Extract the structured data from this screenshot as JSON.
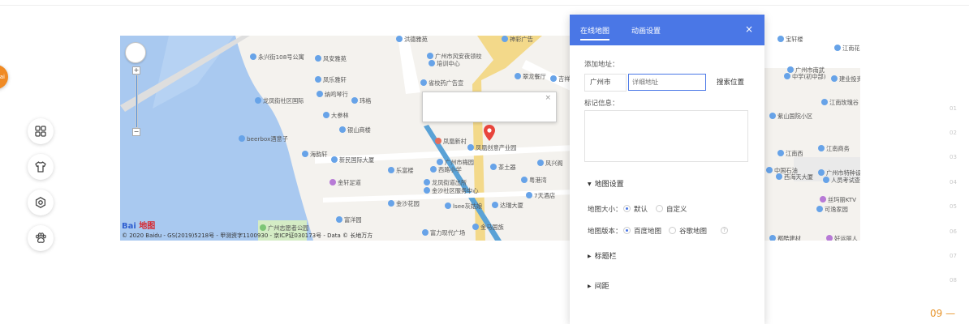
{
  "orange_tab": "ai",
  "toolbar": [
    {
      "name": "grid-icon"
    },
    {
      "name": "shirt-icon"
    },
    {
      "name": "settings-icon"
    },
    {
      "name": "paw-icon"
    }
  ],
  "map": {
    "pois": [
      {
        "t": "洪德雅苑",
        "c": "#67a3e8"
      },
      {
        "t": "神彩广告",
        "c": "#67a3e8"
      },
      {
        "t": "永兴街108号公寓",
        "c": "#67a3e8"
      },
      {
        "t": "风安雅苑",
        "c": "#67a3e8"
      },
      {
        "t": "广州市风安夜领校",
        "c": "#67a3e8"
      },
      {
        "t": "培训中心",
        "c": "#67a3e8"
      },
      {
        "t": "凤乐雅轩",
        "c": "#67a3e8"
      },
      {
        "t": "省校药广告宣",
        "c": "#67a3e8"
      },
      {
        "t": "翠龙餐厅",
        "c": "#67a3e8"
      },
      {
        "t": "吉祥永照",
        "c": "#67a3e8"
      },
      {
        "t": "龙凤街社区国际",
        "c": "#67a3e8"
      },
      {
        "t": "纳鸣琴行",
        "c": "#67a3e8"
      },
      {
        "t": "玮格",
        "c": "#67a3e8"
      },
      {
        "t": "大参林",
        "c": "#67a3e8"
      },
      {
        "t": "银山商楼",
        "c": "#67a3e8"
      },
      {
        "t": "beerbox酒意子",
        "c": "#67a3e8"
      },
      {
        "t": "凤凰新村",
        "c": "#e56c5a"
      },
      {
        "t": "凤凰创意产业园",
        "c": "#67a3e8"
      },
      {
        "t": "海韵轩",
        "c": "#67a3e8"
      },
      {
        "t": "新民国际大厦",
        "c": "#67a3e8"
      },
      {
        "t": "广州市梅园",
        "c": "#67a3e8"
      },
      {
        "t": "西路小学",
        "c": "#67a3e8"
      },
      {
        "t": "风兴阁",
        "c": "#67a3e8"
      },
      {
        "t": "乐富楼",
        "c": "#67a3e8"
      },
      {
        "t": "茶土器",
        "c": "#67a3e8"
      },
      {
        "t": "粤港湾",
        "c": "#67a3e8"
      },
      {
        "t": "金轩足道",
        "c": "#b77ad6"
      },
      {
        "t": "龙凤街道出所",
        "c": "#67a3e8"
      },
      {
        "t": "金沙社区服务中心",
        "c": "#67a3e8"
      },
      {
        "t": "7天酒店",
        "c": "#67a3e8"
      },
      {
        "t": "金沙花园",
        "c": "#67a3e8"
      },
      {
        "t": "lsee灰姑娘",
        "c": "#67a3e8"
      },
      {
        "t": "达瑞大厦",
        "c": "#67a3e8"
      },
      {
        "t": "富洋园",
        "c": "#67a3e8"
      },
      {
        "t": "金马国族",
        "c": "#67a3e8"
      },
      {
        "t": "富力现代广场",
        "c": "#67a3e8"
      },
      {
        "t": "广州志愿者公园",
        "c": "#7cc576"
      },
      {
        "t": "宝轩楼",
        "c": "#67a3e8"
      },
      {
        "t": "江南花",
        "c": "#67a3e8"
      },
      {
        "t": "广州市南武",
        "c": "#67a3e8"
      },
      {
        "t": "中学(初中部)",
        "c": "#67a3e8"
      },
      {
        "t": "建业投资",
        "c": "#67a3e8"
      },
      {
        "t": "江南玫瑰谷",
        "c": "#67a3e8"
      },
      {
        "t": "紫山国院小区",
        "c": "#67a3e8"
      },
      {
        "t": "江南西",
        "c": "#67a3e8"
      },
      {
        "t": "江南商务",
        "c": "#67a3e8"
      },
      {
        "t": "中国石油",
        "c": "#67a3e8"
      },
      {
        "t": "广州市特种设备检",
        "c": "#67a3e8"
      },
      {
        "t": "西海天大厦",
        "c": "#67a3e8"
      },
      {
        "t": "人员考试查",
        "c": "#67a3e8"
      },
      {
        "t": "丝玛丽KTV",
        "c": "#b77ad6"
      },
      {
        "t": "可逸家园",
        "c": "#67a3e8"
      },
      {
        "t": "都酷建材",
        "c": "#67a3e8"
      },
      {
        "t": "好运丽人",
        "c": "#b77ad6"
      }
    ],
    "popup_close": "×",
    "logo_a": "Bai",
    "logo_b": "地图",
    "copyright": "© 2020 Baidu - GS(2019)5218号 - 甲测资字1100930 - 京ICP证030173号 - Data © 长地万方"
  },
  "panel": {
    "tabs": [
      "在线地图",
      "动画设置"
    ],
    "close": "×",
    "add_address_label": "添加地址：",
    "city": "广州市",
    "address_placeholder": "详细地址",
    "search_button": "搜索位置",
    "marker_info_label": "标记信息：",
    "map_settings": "地图设置",
    "map_size_label": "地图大小：",
    "size_default": "默认",
    "size_custom": "自定义",
    "map_version_label": "地图版本：",
    "version_baidu": "百度地图",
    "version_google": "谷歌地图",
    "help": "?",
    "title_bar": "标题栏",
    "spacing": "间距"
  },
  "pages": [
    "01",
    "02",
    "03",
    "04",
    "05",
    "06",
    "07",
    "08",
    "09 —"
  ]
}
